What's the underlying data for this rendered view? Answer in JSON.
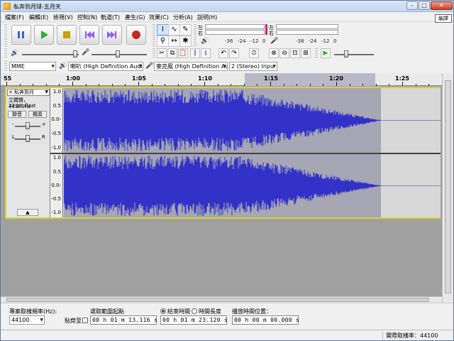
{
  "window": {
    "title": "私奔到月球-五月天",
    "minimize_glyph": "–",
    "maximize_glyph": "□",
    "close_glyph": "✕",
    "help_tip": "編譯"
  },
  "menu": [
    {
      "label": "檔案(F)"
    },
    {
      "label": "編輯(E)"
    },
    {
      "label": "檢視(V)"
    },
    {
      "label": "控制(N)"
    },
    {
      "label": "軌道(T)"
    },
    {
      "label": "產生(G)"
    },
    {
      "label": "效果(C)"
    },
    {
      "label": "分析(A)"
    },
    {
      "label": "說明(H)"
    }
  ],
  "transport": {
    "pause_icon": "pause-icon",
    "play_icon": "play-icon",
    "stop_icon": "stop-icon",
    "skip_start_icon": "skip-to-start-icon",
    "skip_end_icon": "skip-to-end-icon",
    "record_icon": "record-icon",
    "colors": {
      "blue": "#3a5fd8",
      "green": "#2fae2f",
      "olive": "#c8a000",
      "purple": "#8b5cf6",
      "red": "#c0282c"
    }
  },
  "tools": [
    {
      "glyph": "I",
      "name": "selection-tool-icon"
    },
    {
      "glyph": "∿",
      "name": "envelope-tool-icon"
    },
    {
      "glyph": "✎",
      "name": "draw-tool-icon"
    },
    {
      "glyph": "⚲",
      "name": "zoom-tool-icon"
    },
    {
      "glyph": "↔",
      "name": "time-shift-tool-icon"
    },
    {
      "glyph": "✱",
      "name": "multi-tool-icon"
    }
  ],
  "meters": {
    "play_left": "左",
    "play_right": "右",
    "rec_left": "左",
    "rec_right": "右",
    "ticks": [
      "-36",
      "-24",
      "-12",
      "0",
      "-36",
      "-24",
      "-12",
      "0"
    ],
    "play_tick_labels": [
      "-36",
      "-24",
      "-12",
      "0"
    ],
    "rec_tick_labels": [
      "-38",
      "-24",
      "-12",
      "0"
    ]
  },
  "edit_toolbar": {
    "buttons": [
      "cut-icon",
      "copy-icon",
      "paste-icon",
      "trim-icon",
      "silence-icon",
      "undo-icon",
      "redo-icon",
      "sync-lock-icon",
      "zoom-in-icon",
      "zoom-out-icon",
      "fit-selection-icon",
      "fit-project-icon",
      "play-at-speed-icon"
    ]
  },
  "device": {
    "host": "MME",
    "output": "喇叭 (High Definition Audic",
    "input": "麥克風 (High Definition Au",
    "channels": "2 (Stereo) Inpu"
  },
  "timeline": {
    "labels": [
      "55",
      "1:00",
      "1:05",
      "1:10",
      "1:15",
      "1:20",
      "1:25"
    ]
  },
  "track": {
    "name": "私奔到月",
    "info1": "立體聲，44100Hz",
    "info2": "32-bit float",
    "mute": "靜音",
    "solo": "獨奏",
    "gain_minus": "-",
    "gain_plus": "+",
    "pan_left": "L",
    "pan_right": "R",
    "collapse_glyph": "▲",
    "close_glyph": "✕",
    "menu_glyph": "▼",
    "ruler_labels": [
      "1.0",
      "0.5",
      "0.0-",
      "-0.5",
      "-1.0"
    ],
    "waveform_color": "#3232c8",
    "selection_color": "#a6a6b4"
  },
  "selection_bar": {
    "rate_label": "專案取樣頻率(Hz):",
    "rate_value": "44100",
    "snap_label": "貼齊至",
    "start_label": "選取範圍起點",
    "end_radio": "結束時間",
    "length_radio": "時間長度",
    "position_label": "播放時間位置：",
    "start_value": "00 h 01 m 13.116 s",
    "end_value": "00 h 01 m 23.120 s",
    "position_value": "00 h 00 m 00.000 s"
  },
  "status": {
    "text": "實際取樣率：44100"
  }
}
